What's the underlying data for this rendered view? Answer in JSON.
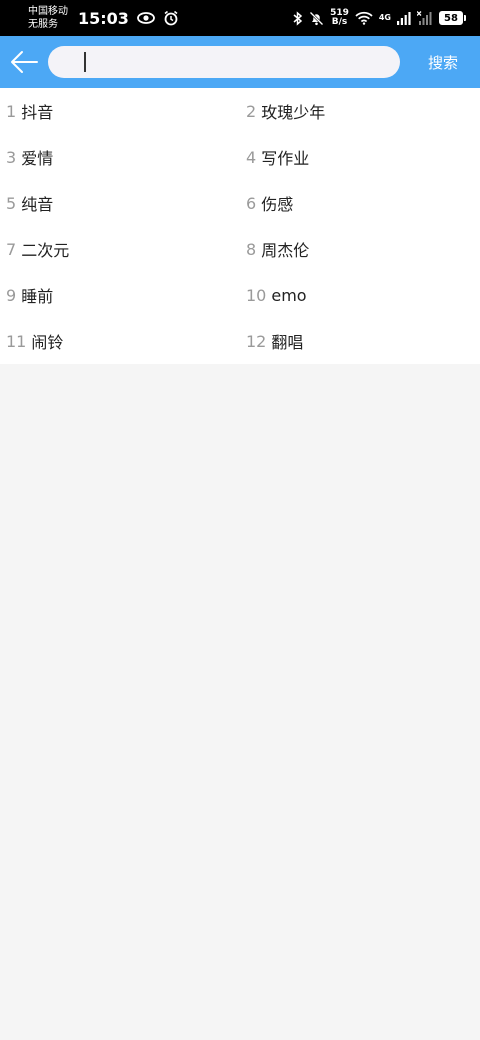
{
  "status_bar": {
    "carrier_1": "中国移动",
    "carrier_2": "无服务",
    "time": "15:03",
    "net_speed_value": "519",
    "net_speed_unit": "B/s",
    "network_type": "4G",
    "battery": "58",
    "icons": [
      "eye-icon",
      "alarm-icon",
      "bluetooth-icon",
      "mute-bell-icon",
      "wifi-icon",
      "signal-icon",
      "no-signal-icon",
      "battery-icon"
    ]
  },
  "header": {
    "search_placeholder": "",
    "search_value": "",
    "search_button": "搜索",
    "colors": {
      "header_bg": "#4ca8f5",
      "input_bg": "#f4f3f8"
    }
  },
  "hot_keywords": [
    {
      "rank": "1",
      "label": "抖音"
    },
    {
      "rank": "2",
      "label": "玫瑰少年"
    },
    {
      "rank": "3",
      "label": "爱情"
    },
    {
      "rank": "4",
      "label": "写作业"
    },
    {
      "rank": "5",
      "label": "纯音"
    },
    {
      "rank": "6",
      "label": "伤感"
    },
    {
      "rank": "7",
      "label": "二次元"
    },
    {
      "rank": "8",
      "label": "周杰伦"
    },
    {
      "rank": "9",
      "label": "睡前"
    },
    {
      "rank": "10",
      "label": "emo"
    },
    {
      "rank": "11",
      "label": "闹铃"
    },
    {
      "rank": "12",
      "label": "翻唱"
    }
  ]
}
